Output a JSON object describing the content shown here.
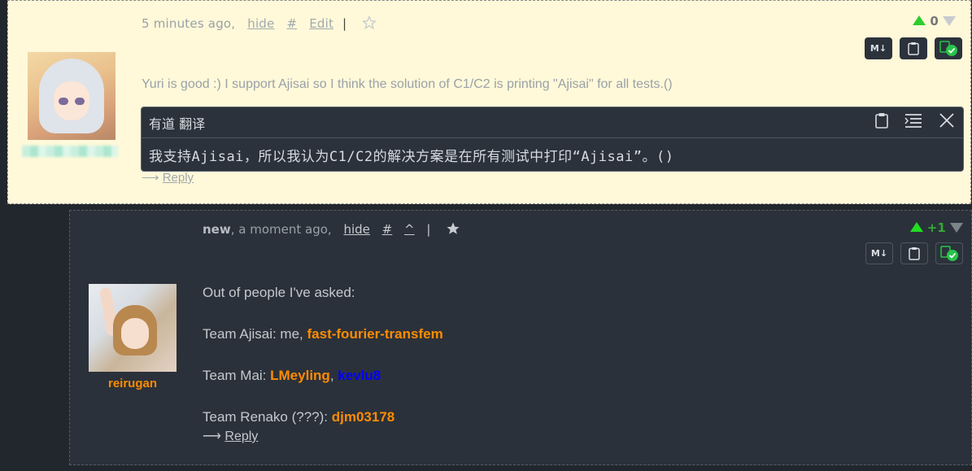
{
  "comment1": {
    "time": "5 minutes ago,",
    "hide": "hide",
    "hash": "#",
    "edit": "Edit",
    "sep": "|",
    "vote": "0",
    "buttons": {
      "markdown": "M↓"
    },
    "body": "Yuri is good :) I support Ajisai so I think the solution of C1/C2 is printing \"Ajisai\" for all tests.()",
    "reply_arrow": "⟶",
    "reply": "Reply"
  },
  "translation": {
    "header": "有道 翻译",
    "text": "我支持Ajisai，所以我认为C1/C2的解决方案是在所有测试中打印“Ajisai”。()"
  },
  "comment2": {
    "new_label": "new",
    "time": ", a moment ago,",
    "hide": "hide",
    "hash": "#",
    "up": "^",
    "sep": "|",
    "vote": "+1",
    "buttons": {
      "markdown": "M↓"
    },
    "username": "reirugan",
    "lines": {
      "l1": "Out of people I've asked:",
      "l2_prefix": "Team Ajisai: me, ",
      "l2_user": "fast-fourier-transfem",
      "l3_prefix": "Team Mai: ",
      "l3_user1": "LMeyling",
      "l3_comma": ", ",
      "l3_user2": "kevlu8",
      "l4_prefix": "Team Renako (???): ",
      "l4_user": "djm03178"
    },
    "reply_arrow": "⟶",
    "reply": "Reply"
  },
  "colors": {
    "orange_user": "#ff8c00",
    "blue_user": "#0000ff",
    "highlight_bg": "#fff9d9",
    "vote_up": "#22dd22"
  },
  "icons": [
    "star-outline-icon",
    "star-filled-icon",
    "upvote-icon",
    "downvote-icon",
    "markdown-icon",
    "clipboard-icon",
    "translate-check-icon",
    "list-icon",
    "close-icon"
  ]
}
